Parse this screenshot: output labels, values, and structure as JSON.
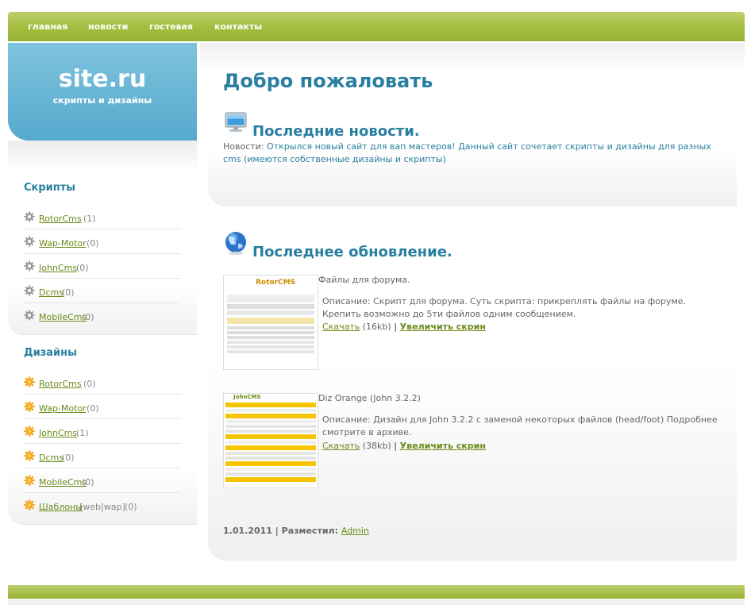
{
  "nav": {
    "items": [
      "главная",
      "новости",
      "гостевая",
      "контакты"
    ]
  },
  "logo": {
    "title": "site.ru",
    "subtitle": "скрипты и дизайны"
  },
  "sidebar": {
    "scripts_heading": "Скрипты",
    "scripts": [
      {
        "label": "RotorCms",
        "count": "(1)"
      },
      {
        "label": "Wap-Motor",
        "count": "(0)"
      },
      {
        "label": "JohnCms",
        "count": "(0)"
      },
      {
        "label": "Dcms",
        "count": "(0)"
      },
      {
        "label": "MobileCms",
        "count": "(0)"
      }
    ],
    "designs_heading": "Дизайны",
    "designs": [
      {
        "label": "RotorCms",
        "count": "(0)",
        "extra": ""
      },
      {
        "label": "Wap-Motor",
        "count": "(0)",
        "extra": ""
      },
      {
        "label": "JohnCms",
        "count": "(1)",
        "extra": ""
      },
      {
        "label": "Dcms",
        "count": "(0)",
        "extra": ""
      },
      {
        "label": "MobileCms",
        "count": "(0)",
        "extra": ""
      },
      {
        "label": "Шаблоны",
        "count": "(0)",
        "extra": "[web|wap]"
      }
    ]
  },
  "main": {
    "title": "Добро пожаловать",
    "news_heading": "Последние новости.",
    "news_label": "Новости:",
    "news_text": "Открылся новый сайт для вап мастеров! Данный сайт сочетает скрипты и дизайны для разных cms (имеются собственные дизайны и скрипты)",
    "updates_heading": "Последнее обновление.",
    "files": [
      {
        "title": "Файлы для форума.",
        "description": "Описание: Скрипт для форума. Суть скрипта: прикреплять файлы на форуме. Крепить возможно до 5ти файлов одним сообщением.",
        "download": "Скачать",
        "size": "(16kb)",
        "sep": "|",
        "zoom": "Увеличить скрин",
        "thumb_brand": "RotorCMS"
      },
      {
        "title": "Diz Orange (John 3.2.2)",
        "description": "Описание: Дизайн для John 3.2.2 с заменой некоторых файлов (head/foot) Подробнее смотрите в архиве.",
        "download": "Скачать",
        "size": "(38kb)",
        "sep": "|",
        "zoom": "Увеличить скрин",
        "thumb_brand": "JohnCMS"
      }
    ],
    "date": "1.01.2011",
    "posted_by_label": "| Разместил:",
    "author": "Admin"
  },
  "colors": {
    "accent_green": "#a4bd3f",
    "accent_blue": "#56a9cd",
    "heading_blue": "#2a7fa0",
    "link_green": "#6b8a18"
  }
}
